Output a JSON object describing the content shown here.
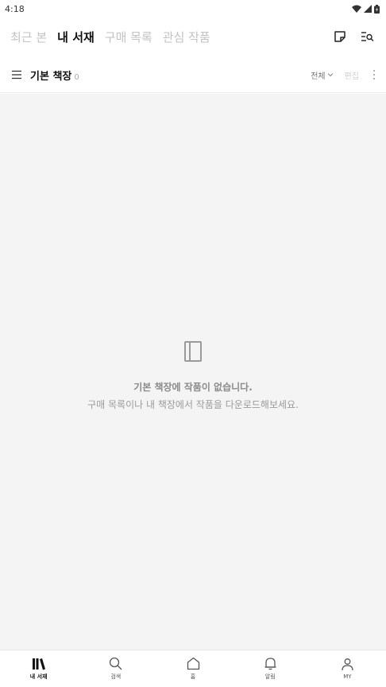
{
  "status_bar": {
    "time": "4:18",
    "icons": [
      "wifi-icon",
      "signal-icon",
      "battery-icon"
    ]
  },
  "top_tabs": [
    {
      "label": "최근 본",
      "active": false
    },
    {
      "label": "내 서재",
      "active": true
    },
    {
      "label": "구매 목록",
      "active": false
    },
    {
      "label": "관심 작품",
      "active": false
    }
  ],
  "top_actions": [
    "memo-icon",
    "list-search-icon"
  ],
  "shelf": {
    "title": "기본 책장",
    "count": "0",
    "filter_label": "전체",
    "edit_label": "편집"
  },
  "empty_state": {
    "title": "기본 책장에 작품이 없습니다.",
    "description": "구매 목록이나 내 책장에서 작품을 다운로드해보세요."
  },
  "bottom_nav": [
    {
      "label": "내 서재",
      "icon": "library-icon",
      "active": true
    },
    {
      "label": "검색",
      "icon": "search-icon",
      "active": false
    },
    {
      "label": "홈",
      "icon": "home-icon",
      "active": false
    },
    {
      "label": "알림",
      "icon": "bell-icon",
      "active": false
    },
    {
      "label": "MY",
      "icon": "person-icon",
      "active": false
    }
  ],
  "colors": {
    "active_text": "#111111",
    "inactive_text": "#c2c2c2",
    "content_bg": "#f4f4f4"
  }
}
